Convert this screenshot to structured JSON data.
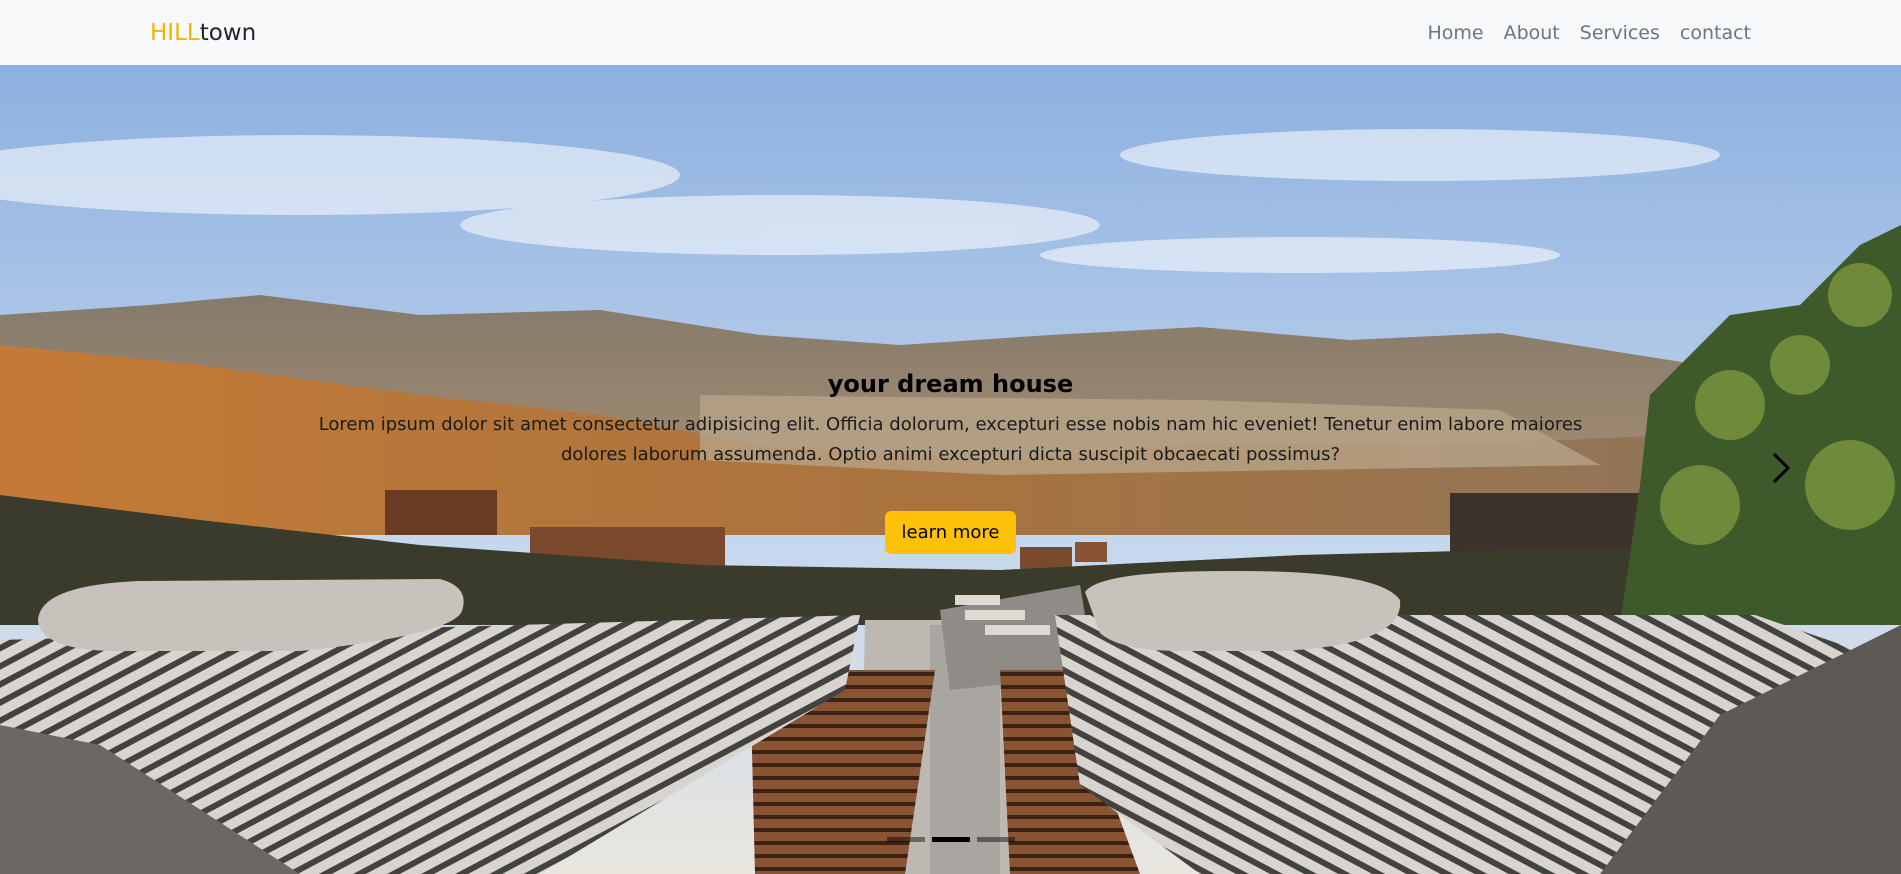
{
  "navbar": {
    "brand_part1": "HILL",
    "brand_part2": "town",
    "links": [
      "Home",
      "About",
      "Services",
      "contact"
    ]
  },
  "hero": {
    "title": "your dream house",
    "text": "Lorem ipsum dolor sit amet consectetur adipisicing elit. Officia dolorum, excepturi esse nobis nam hic eveniet! Tenetur enim labore maiores dolores laborum assumenda. Optio animi excepturi dicta suscipit obcaecati possimus?",
    "button_label": "learn more",
    "next_icon": "chevron-right-icon",
    "slides_count": 3,
    "active_slide": 2
  },
  "colors": {
    "accent": "#ffc107",
    "brand": "#f4b400",
    "nav_bg": "#f8f9fa"
  }
}
